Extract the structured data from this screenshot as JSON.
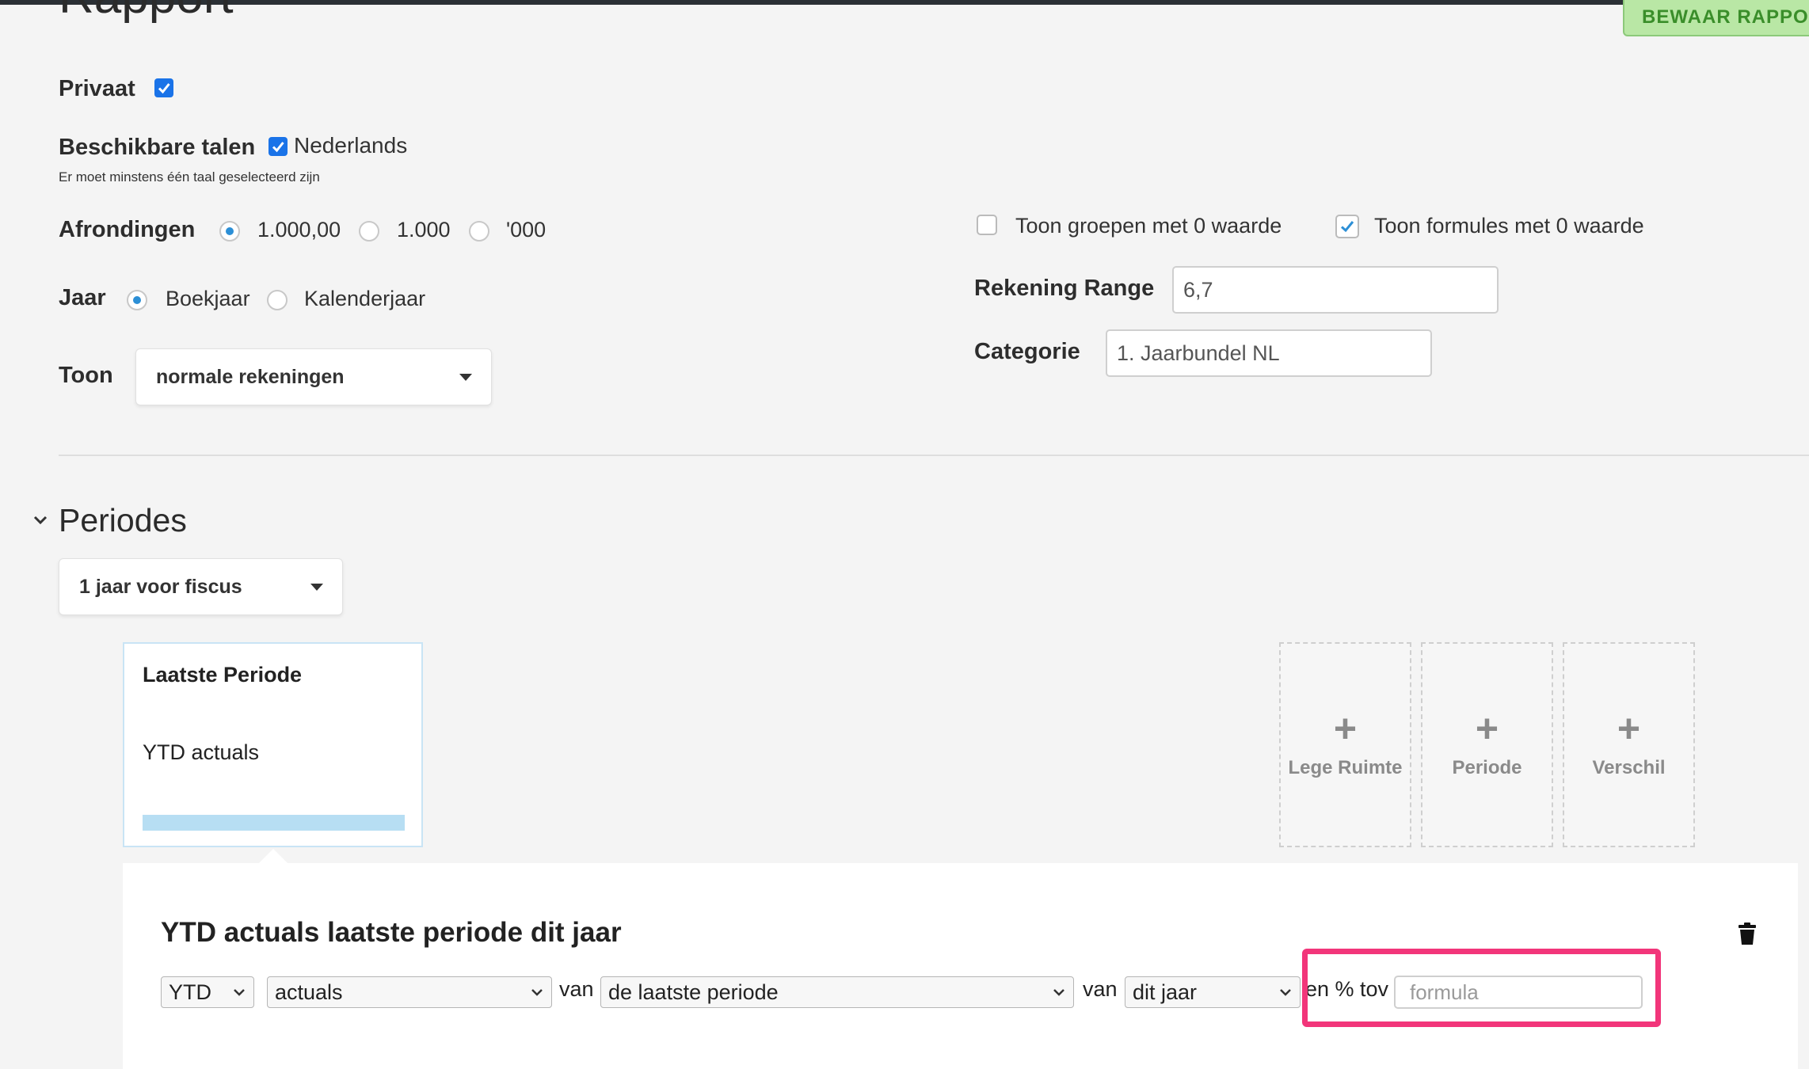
{
  "header": {
    "title": "Rapport",
    "save_label": "BEWAAR RAPPORT"
  },
  "settings": {
    "private_label": "Privaat",
    "languages_label": "Beschikbare talen",
    "language_option": "Nederlands",
    "languages_hint": "Er moet minstens één taal geselecteerd zijn",
    "rounding_label": "Afrondingen",
    "rounding_options": [
      "1.000,00",
      "1.000",
      "'000"
    ],
    "year_label": "Jaar",
    "year_options": [
      "Boekjaar",
      "Kalenderjaar"
    ],
    "show_label": "Toon",
    "show_value": "normale rekeningen",
    "show_groups_zero": "Toon groepen met 0 waarde",
    "show_formulas_zero": "Toon formules met 0 waarde",
    "account_range_label": "Rekening Range",
    "account_range_value": "6,7",
    "category_label": "Categorie",
    "category_value": "1. Jaarbundel NL"
  },
  "periods": {
    "title": "Periodes",
    "preset_value": "1 jaar voor fiscus",
    "card": {
      "title": "Laatste Periode",
      "subtitle": "YTD actuals"
    },
    "add_tiles": [
      "Lege Ruimte",
      "Periode",
      "Verschil"
    ]
  },
  "editor": {
    "title": "YTD actuals laatste periode dit jaar",
    "select_type": "YTD",
    "select_kind": "actuals",
    "word_van_1": "van",
    "select_period": "de laatste periode",
    "word_van_2": "van",
    "select_year": "dit jaar",
    "percent_label": "en % tov",
    "formula_placeholder": "formula"
  },
  "colors": {
    "accent": "#1a73e8",
    "highlight": "#f2357a",
    "save_green": "#b9e7a5"
  }
}
